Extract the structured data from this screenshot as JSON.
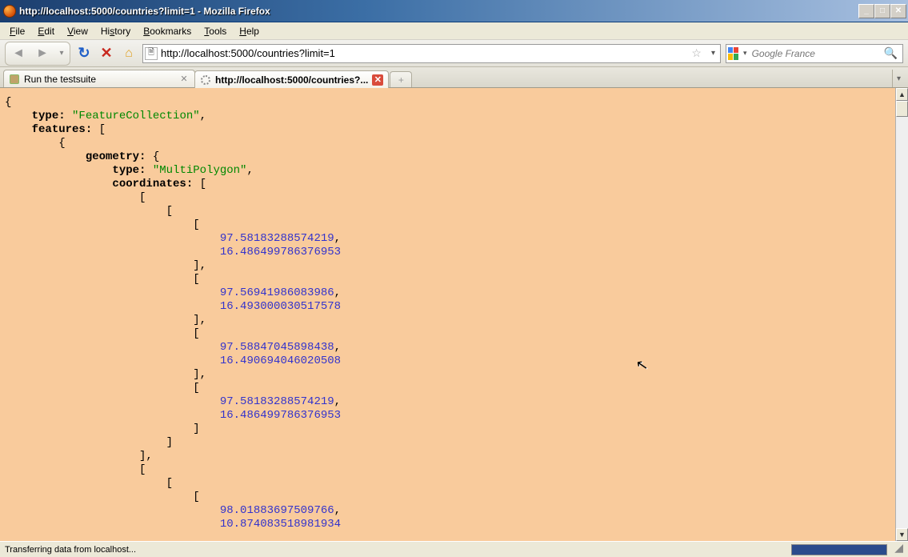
{
  "window": {
    "title": "http://localhost:5000/countries?limit=1 - Mozilla Firefox"
  },
  "menu": {
    "file": "File",
    "edit": "Edit",
    "view": "View",
    "history": "History",
    "bookmarks": "Bookmarks",
    "tools": "Tools",
    "help": "Help"
  },
  "url": "http://localhost:5000/countries?limit=1",
  "search_placeholder": "Google France",
  "tabs": [
    {
      "label": "Run the testsuite"
    },
    {
      "label": "http://localhost:5000/countries?..."
    }
  ],
  "status": "Transferring data from localhost...",
  "json_labels": {
    "type": "type:",
    "features": "features:",
    "geometry": "geometry:",
    "coordinates": "coordinates:"
  },
  "json_values": {
    "featureCollection": "\"FeatureCollection\"",
    "multiPolygon": "\"MultiPolygon\""
  },
  "coords": {
    "p1a": "97.58183288574219",
    "p1b": "16.486499786376953",
    "p2a": "97.56941986083986",
    "p2b": "16.493000030517578",
    "p3a": "97.58847045898438",
    "p3b": "16.490694046020508",
    "p4a": "97.58183288574219",
    "p4b": "16.486499786376953",
    "p5a": "98.01883697509766",
    "p5b": "10.874083518981934"
  }
}
